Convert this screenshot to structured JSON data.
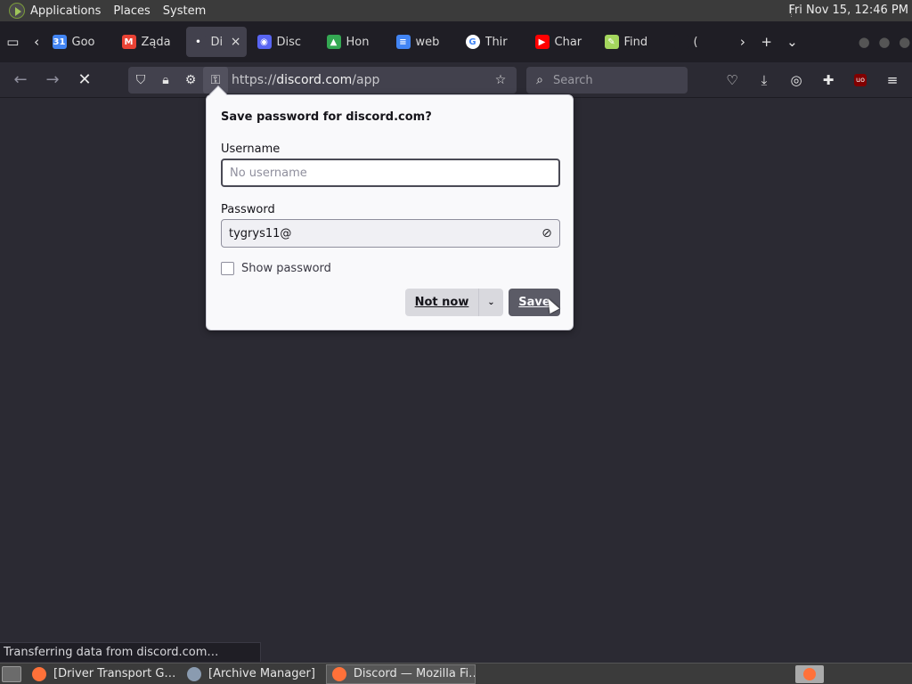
{
  "top_panel": {
    "menus": [
      "Applications",
      "Places",
      "System"
    ],
    "clock": "Fri Nov 15, 12:46 PM"
  },
  "tabs": [
    {
      "label": "Goo",
      "icon": "google-docs-icon",
      "color": "#4285f4",
      "glyph": "31"
    },
    {
      "label": "Żąda",
      "icon": "gmail-icon",
      "color": "#ea4335",
      "glyph": "M"
    },
    {
      "label": "Di",
      "icon": "loading-dot-icon",
      "color": "#42414d",
      "glyph": "•",
      "active": true
    },
    {
      "label": "Disc",
      "icon": "discord-icon",
      "color": "#5865f2",
      "glyph": "◉"
    },
    {
      "label": "Hon",
      "icon": "google-drive-icon",
      "color": "#34a853",
      "glyph": "▲"
    },
    {
      "label": "web",
      "icon": "google-docs-icon",
      "color": "#4285f4",
      "glyph": "≡"
    },
    {
      "label": "Thir",
      "icon": "google-icon",
      "color": "#ffffff",
      "glyph": "G"
    },
    {
      "label": "Char",
      "icon": "youtube-icon",
      "color": "#ff0000",
      "glyph": "▶"
    },
    {
      "label": "Find",
      "icon": "pen-icon",
      "color": "#a4d65e",
      "glyph": "✎"
    },
    {
      "label": "(",
      "icon": "partial-tab-icon",
      "color": "#1f1e25",
      "glyph": ""
    }
  ],
  "navbar": {
    "url_prefix": "https://",
    "url_host": "discord.com",
    "url_path": "/app",
    "search_placeholder": "Search"
  },
  "popup": {
    "title": "Save password for discord.com?",
    "username_label": "Username",
    "username_placeholder": "No username",
    "password_label": "Password",
    "password_value": "tygrys11@",
    "show_password_label": "Show password",
    "not_now_label": "Not now",
    "save_label": "Save"
  },
  "status": "Transferring data from discord.com…",
  "taskbar": {
    "tasks": [
      {
        "label": "[Driver Transport G…",
        "color": "#ff7139"
      },
      {
        "label": "[Archive Manager]",
        "color": "#8a9bb0"
      },
      {
        "label": "Discord — Mozilla Fi…",
        "color": "#ff7139",
        "active": true
      }
    ]
  }
}
